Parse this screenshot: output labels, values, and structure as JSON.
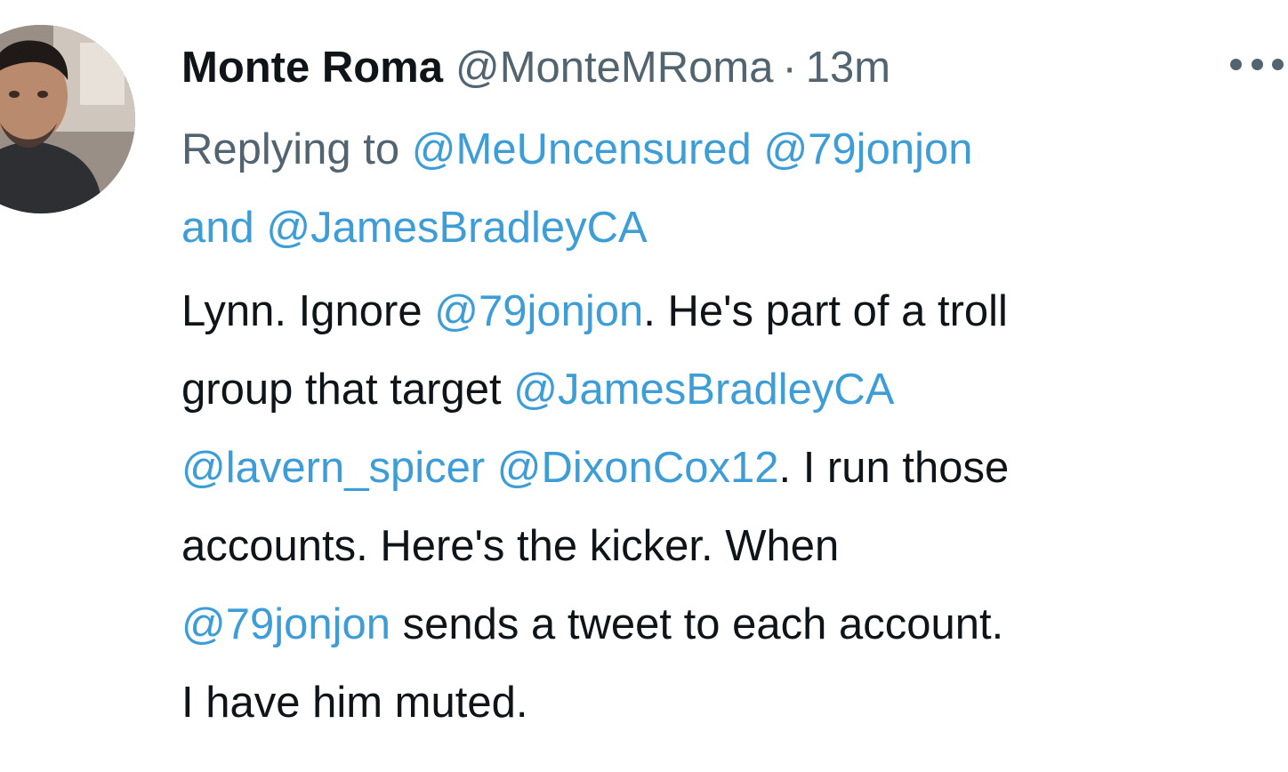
{
  "tweet": {
    "display_name": "Monte Roma",
    "handle": "@MonteMRoma",
    "separator": "·",
    "time": "13m",
    "more_icon": "more-horizontal-icon",
    "avatar": "user-avatar-photo",
    "replying_prefix": "Replying to",
    "replying_mention_1": "@MeUncensured",
    "replying_mention_2": "@79jonjon",
    "replying_and": "and",
    "replying_mention_3": "@JamesBradleyCA",
    "body": {
      "l1_a": "Lynn. Ignore",
      "l1_m": "@79jonjon",
      "l1_b": ". He's part of a troll",
      "l2_a": "group that target",
      "l2_m": "@JamesBradleyCA",
      "l3_m1": "@lavern_spicer",
      "l3_m2": "@DixonCox12",
      "l3_b": ". I run those",
      "l4": "accounts. Here's the kicker. When",
      "l5_m": "@79jonjon",
      "l5_b": "sends a tweet to each account.",
      "l6": "I have him muted."
    }
  },
  "colors": {
    "mention": "#3d9dd6",
    "secondary_text": "#536471",
    "primary_text": "#0f1419"
  }
}
